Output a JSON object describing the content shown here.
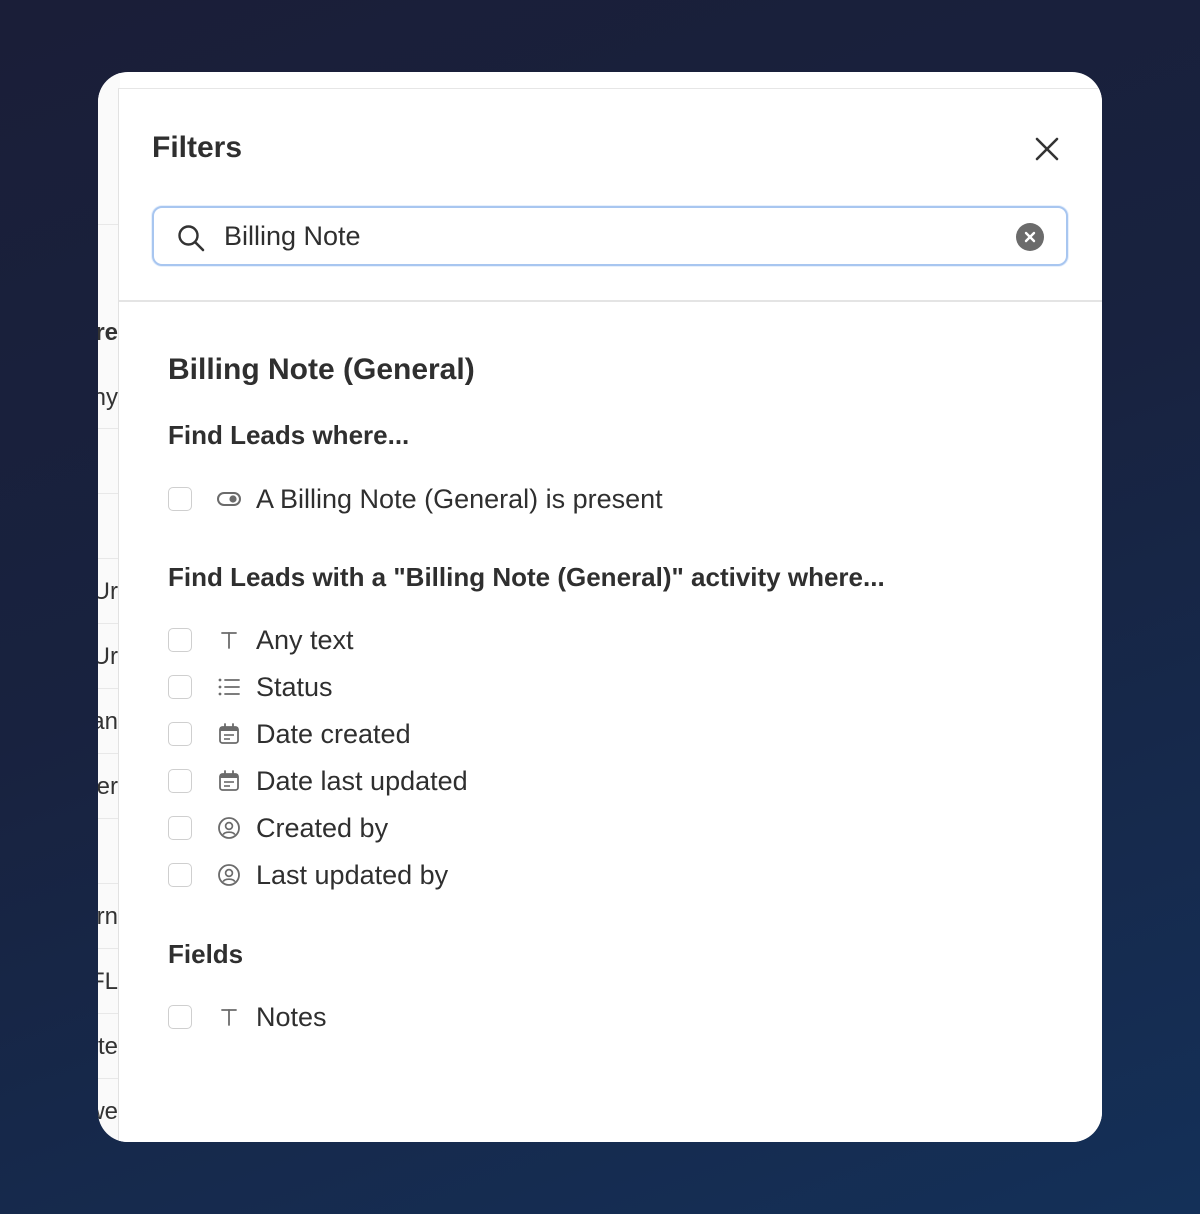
{
  "panel": {
    "title": "Filters",
    "close_icon": "close-icon"
  },
  "search": {
    "value": "Billing Note",
    "icon": "search-icon",
    "clear_icon": "clear-icon"
  },
  "results": {
    "section_title": "Billing Note (General)",
    "presence_group": {
      "heading": "Find Leads where...",
      "options": [
        {
          "label": "A Billing Note (General) is present",
          "icon": "toggle-icon"
        }
      ]
    },
    "activity_group": {
      "heading": "Find Leads with a \"Billing Note (General)\" activity where...",
      "options": [
        {
          "label": "Any text",
          "icon": "text-icon"
        },
        {
          "label": "Status",
          "icon": "list-icon"
        },
        {
          "label": "Date created",
          "icon": "calendar-icon"
        },
        {
          "label": "Date last updated",
          "icon": "calendar-icon"
        },
        {
          "label": "Created by",
          "icon": "user-circle-icon"
        },
        {
          "label": "Last updated by",
          "icon": "user-circle-icon"
        }
      ]
    },
    "fields_group": {
      "heading": "Fields",
      "options": [
        {
          "label": "Notes",
          "icon": "text-icon"
        }
      ]
    }
  },
  "background_table": {
    "cells": [
      "re",
      "ny",
      "Ur",
      "Ur",
      "an",
      "er",
      "rn",
      "FL",
      "te",
      "we"
    ]
  },
  "colors": {
    "search_focus_border": "#a8c6f0",
    "text": "#2f2f2f",
    "icon_gray": "#6b6b6b",
    "checkbox_border": "#cfcfcf"
  }
}
